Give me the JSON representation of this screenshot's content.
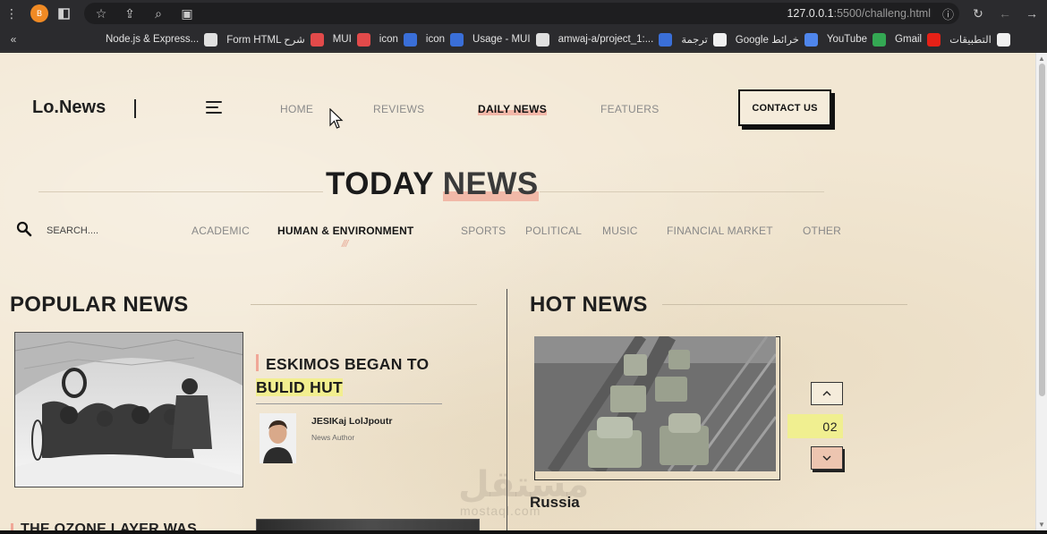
{
  "browser": {
    "profile_initial": "B",
    "url_host": "127.0.0.1",
    "url_rest": ":5500/challeng.html",
    "bookmarks": [
      {
        "label": "Node.js & Express...",
        "color": "#e0e0e0"
      },
      {
        "label": "Form HTML شرح",
        "color": "#e24a4a"
      },
      {
        "label": "MUI",
        "color": "#e24a4a"
      },
      {
        "label": "icon",
        "color": "#3a6fd8"
      },
      {
        "label": "icon",
        "color": "#3a6fd8"
      },
      {
        "label": "Usage - MUI",
        "color": "#e0e0e0"
      },
      {
        "label": "amwaj-a/project_1:...",
        "color": "#3a6fd8"
      },
      {
        "label": "ترجمة",
        "color": "#f0f0f0"
      },
      {
        "label": "Google خرائط",
        "color": "#4f86ec"
      },
      {
        "label": "YouTube",
        "color": "#34a853"
      },
      {
        "label": "Gmail",
        "color": "#e62117"
      },
      {
        "label": "التطبيقات",
        "color": "#f0f0f0"
      }
    ]
  },
  "site": {
    "logo": "Lo.News",
    "nav": {
      "home": "HOME",
      "reviews": "REVIEWS",
      "daily_news": "DAILY NEWS",
      "features": "FEATUERS"
    },
    "contact_label": "CONTACT US"
  },
  "hero": {
    "title_plain": "TODAY ",
    "title_highlight": "NEWS"
  },
  "filter": {
    "search_placeholder": "SEARCH....",
    "categories": {
      "academic": "ACADEMIC",
      "human_env": "HUMAN & ENVIRONMENT",
      "sports": "SPORTS",
      "political": "POLITICAL",
      "music": "MUSIC",
      "financial": "FINANCIAL MARKET",
      "other": "OTHER"
    },
    "active_marks": "///"
  },
  "popular": {
    "title": "POPULAR NEWS",
    "article_title_line1": "ESKIMOS BEGAN TO",
    "article_title_line2": "BULID HUT",
    "author_name": "JESIKaj LolJpoutr",
    "author_role": "News Author",
    "next_article_title": "THE OZONE LAYER WAS"
  },
  "hot": {
    "title": "HOT NEWS",
    "caption": "Russia",
    "counter": "02"
  },
  "watermark": {
    "main": "مستقل",
    "sub": "mostaql.com"
  },
  "colors": {
    "page_bg": "#f2e7d3",
    "highlight_pink": "#f1b9a8",
    "highlight_yellow": "#f2ee8f",
    "counter_yellow": "#f0ef90"
  }
}
